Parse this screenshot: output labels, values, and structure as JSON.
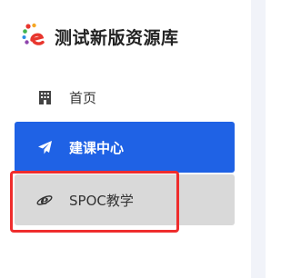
{
  "brand": {
    "title": "测试新版资源库"
  },
  "menu": {
    "items": [
      {
        "label": "首页",
        "icon": "building-icon",
        "active": false
      },
      {
        "label": "建课中心",
        "icon": "paper-plane-icon",
        "active": true
      },
      {
        "label": "SPOC教学",
        "icon": "ie-browser-icon",
        "active": false,
        "hover": true
      }
    ]
  },
  "colors": {
    "active_bg": "#1f62e5",
    "hover_bg": "#d9d9d9",
    "highlight_border": "#ef2d2d",
    "right_strip": "#f1f3f9"
  }
}
